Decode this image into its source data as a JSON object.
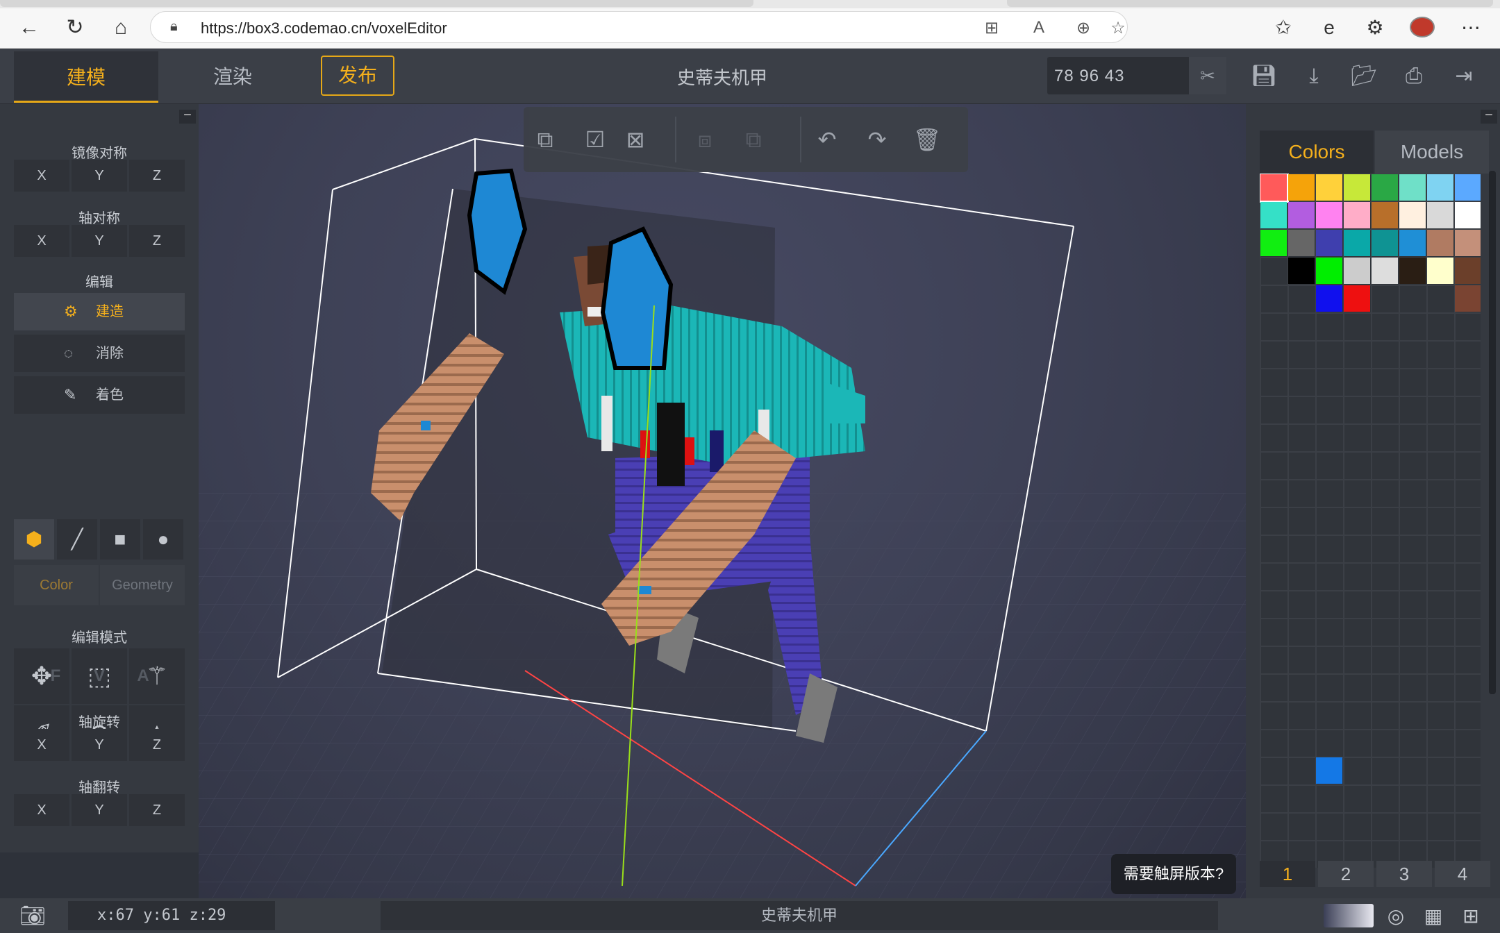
{
  "browser": {
    "url": "https://box3.codemao.cn/voxelEditor"
  },
  "topbar": {
    "tab_build": "建模",
    "tab_render": "渲染",
    "publish": "发布",
    "title": "史蒂夫机甲",
    "coords": "78  96  43"
  },
  "left": {
    "mirror_label": "镜像对称",
    "axis_sym_label": "轴对称",
    "edit_label": "编辑",
    "build": "建造",
    "erase": "消除",
    "paint": "着色",
    "mode_color": "Color",
    "mode_geometry": "Geometry",
    "edit_mode_label": "编辑模式",
    "rotate_label": "轴旋转",
    "flip_label": "轴翻转",
    "axes": [
      "X",
      "Y",
      "Z"
    ],
    "fva": [
      "F",
      "V",
      "A"
    ]
  },
  "right": {
    "tab_colors": "Colors",
    "tab_models": "Models",
    "pages": [
      "1",
      "2",
      "3",
      "4"
    ],
    "palette": [
      [
        "#ff5a5a",
        "#f5a30a",
        "#ffd13a",
        "#c7e839",
        "#2aa845",
        "#6fe0c8",
        "#7fd3f2",
        "#5ba9ff"
      ],
      [
        "#35e0c7",
        "#b25de0",
        "#ff82f0",
        "#ffadc8",
        "#b86f2a",
        "#fff0e0",
        "#d9d9d9",
        "#ffffff"
      ],
      [
        "#11ee11",
        "#666666",
        "#3f3fae",
        "#0aa8a8",
        "#0f9393",
        "#1f8fd6",
        "#b07b62",
        "#c4907a"
      ],
      [
        "",
        "#000000",
        "#00ee00",
        "#cccccc",
        "#dddddd",
        "#2a1e14",
        "#ffffcc",
        "#6b3f2a"
      ],
      [
        "",
        "",
        "#1010ee",
        "#ee1010",
        "",
        "",
        "",
        "#7a4432"
      ]
    ],
    "palette_extra": "#1478e6"
  },
  "viewport": {
    "touch_hint": "需要触屏版本?"
  },
  "status": {
    "cursor": "x:67  y:61  z:29",
    "name": "史蒂夫机甲"
  }
}
